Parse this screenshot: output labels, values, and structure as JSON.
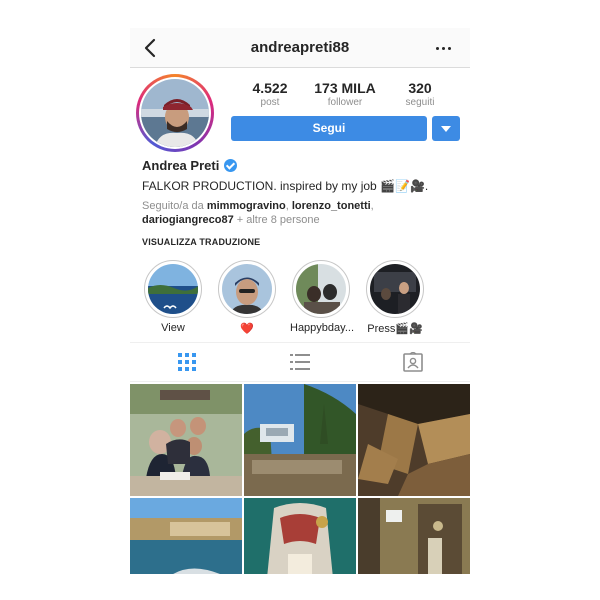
{
  "header": {
    "username": "andreapreti88",
    "back_icon": "chevron-left-icon",
    "more_icon": "ellipsis-icon"
  },
  "profile": {
    "stats": [
      {
        "value": "4.522",
        "label": "post"
      },
      {
        "value": "173 MILA",
        "label": "follower"
      },
      {
        "value": "320",
        "label": "seguiti"
      }
    ],
    "follow_label": "Segui",
    "accent_color": "#3d8be4",
    "name": "Andrea Preti",
    "verified": true,
    "bio": "FALKOR PRODUCTION. inspired by my job 🎬📝🎥.",
    "followed_by_prefix": "Seguito/a da ",
    "followed_by_users": [
      "mimmogravino",
      "lorenzo_tonetti",
      "dariogiangreco87"
    ],
    "followed_by_suffix": " + altre 8 persone",
    "translate_label": "VISUALIZZA TRADUZIONE"
  },
  "highlights": [
    {
      "label": "View"
    },
    {
      "label": "❤️"
    },
    {
      "label": "Happybday..."
    },
    {
      "label": "Press🎬🎥"
    }
  ],
  "tabs": [
    {
      "icon": "grid-icon",
      "active": true
    },
    {
      "icon": "list-icon",
      "active": false
    },
    {
      "icon": "tagged-icon",
      "active": false
    }
  ]
}
